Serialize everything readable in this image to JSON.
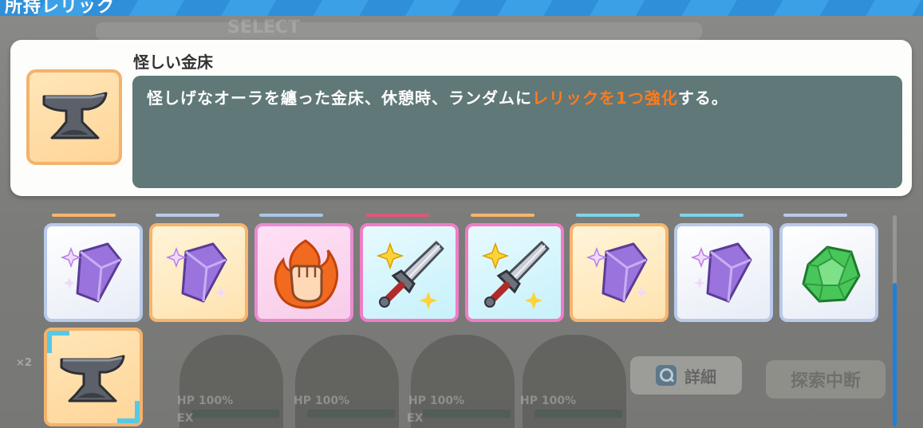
{
  "screen": {
    "title": "所持レリック"
  },
  "background": {
    "select_label": "SELECT",
    "detail_button": "詳細",
    "suspend_button": "探索中断",
    "hp_label": "HP",
    "hp_value": "100%",
    "ep_label": "EX",
    "count_badge": "×2"
  },
  "selected_relic": {
    "icon": "anvil-icon",
    "name": "怪しい金床",
    "description_before": "怪しげなオーラを纏った金床、休憩時、ランダムに",
    "description_highlight": "レリックを1つ強化",
    "description_after": "する。"
  },
  "relics": [
    {
      "icon": "purple-crystal-icon",
      "frame": "blue"
    },
    {
      "icon": "purple-crystal-icon",
      "frame": "orange"
    },
    {
      "icon": "fire-fist-icon",
      "frame": "pink"
    },
    {
      "icon": "sparkle-sword-icon",
      "frame": "cyan"
    },
    {
      "icon": "sparkle-sword-icon",
      "frame": "cyan"
    },
    {
      "icon": "purple-crystal-icon",
      "frame": "orange"
    },
    {
      "icon": "purple-crystal-icon",
      "frame": "blue"
    },
    {
      "icon": "green-gem-icon",
      "frame": "blue"
    },
    {
      "icon": "anvil-icon",
      "frame": "orange",
      "selected": true
    }
  ],
  "colors": {
    "accent_orange": "#ff7a1c",
    "desc_box": "#617878",
    "scroll_thumb": "#1e7fde",
    "selection_corner": "#57c9e7"
  }
}
